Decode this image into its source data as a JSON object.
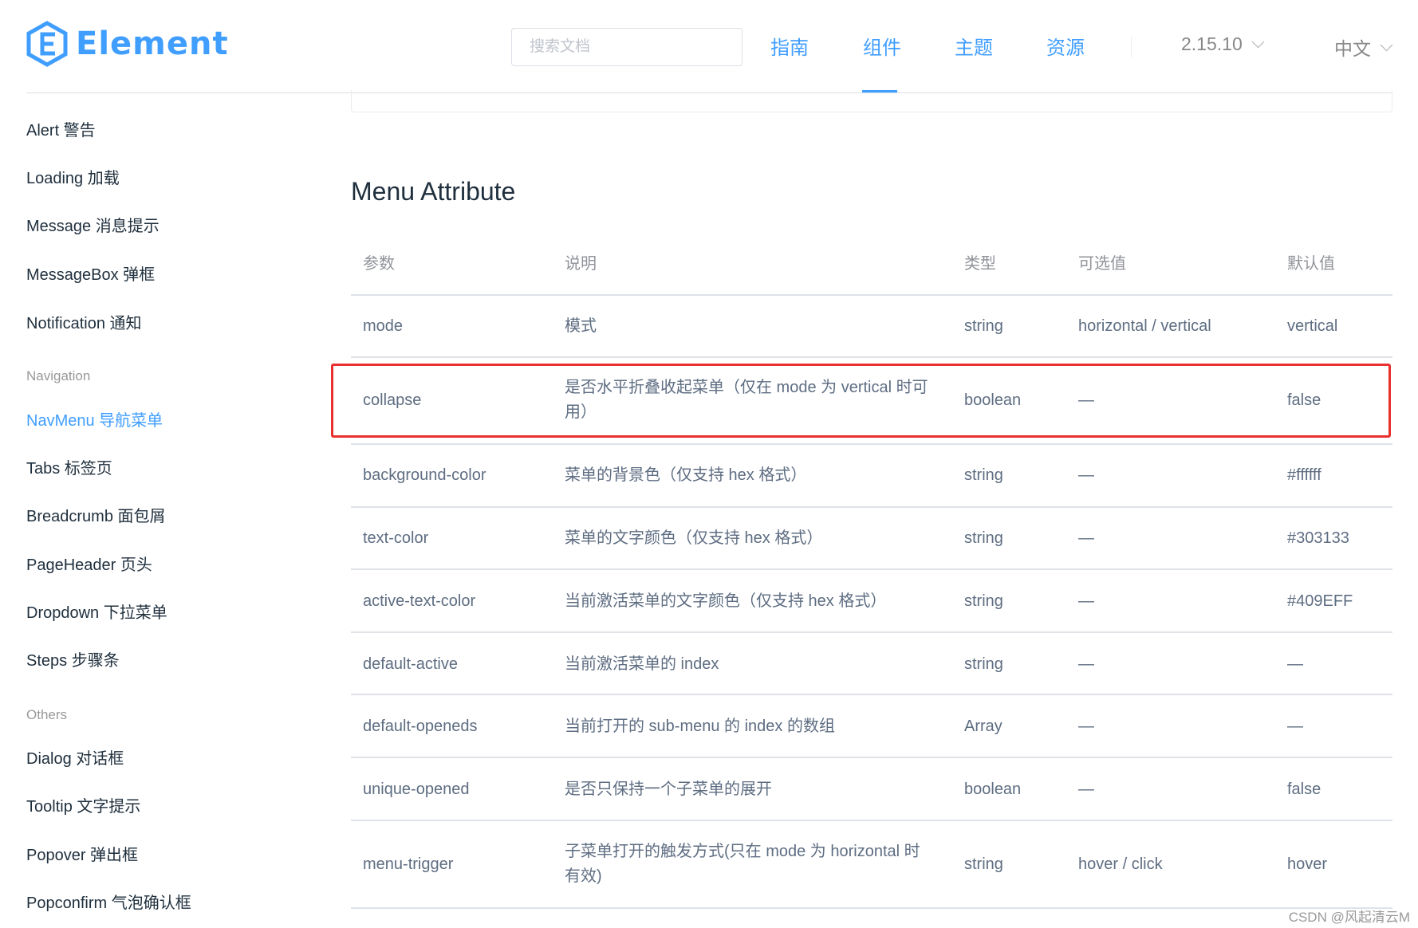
{
  "header": {
    "logo_text": "Element",
    "search_placeholder": "搜索文档",
    "nav": [
      "指南",
      "组件",
      "主题",
      "资源"
    ],
    "active_nav": "组件",
    "version": "2.15.10",
    "language": "中文"
  },
  "sidebar": {
    "items_top": [
      "Alert 警告",
      "Loading 加载",
      "Message 消息提示",
      "MessageBox 弹框",
      "Notification 通知"
    ],
    "group_navigation": "Navigation",
    "items_nav": [
      "NavMenu 导航菜单",
      "Tabs 标签页",
      "Breadcrumb 面包屑",
      "PageHeader 页头",
      "Dropdown 下拉菜单",
      "Steps 步骤条"
    ],
    "active_item": "NavMenu 导航菜单",
    "group_others": "Others",
    "items_others": [
      "Dialog 对话框",
      "Tooltip 文字提示",
      "Popover 弹出框",
      "Popconfirm 气泡确认框"
    ]
  },
  "content": {
    "section_title": "Menu Attribute",
    "columns": [
      "参数",
      "说明",
      "类型",
      "可选值",
      "默认值"
    ],
    "rows": [
      [
        "mode",
        "模式",
        "string",
        "horizontal / vertical",
        "vertical"
      ],
      [
        "collapse",
        "是否水平折叠收起菜单（仅在 mode 为 vertical 时可用）",
        "boolean",
        "—",
        "false"
      ],
      [
        "background-color",
        "菜单的背景色（仅支持 hex 格式）",
        "string",
        "—",
        "#ffffff"
      ],
      [
        "text-color",
        "菜单的文字颜色（仅支持 hex 格式）",
        "string",
        "—",
        "#303133"
      ],
      [
        "active-text-color",
        "当前激活菜单的文字颜色（仅支持 hex 格式）",
        "string",
        "—",
        "#409EFF"
      ],
      [
        "default-active",
        "当前激活菜单的 index",
        "string",
        "—",
        "—"
      ],
      [
        "default-openeds",
        "当前打开的 sub-menu 的 index 的数组",
        "Array",
        "—",
        "—"
      ],
      [
        "unique-opened",
        "是否只保持一个子菜单的展开",
        "boolean",
        "—",
        "false"
      ],
      [
        "menu-trigger",
        "子菜单打开的触发方式(只在 mode 为 horizontal 时有效)",
        "string",
        "hover / click",
        "hover"
      ]
    ],
    "highlighted_row": "collapse"
  },
  "watermark": "CSDN @风起清云M",
  "colors": {
    "accent": "#409eff",
    "highlight_border": "#e9302e"
  }
}
